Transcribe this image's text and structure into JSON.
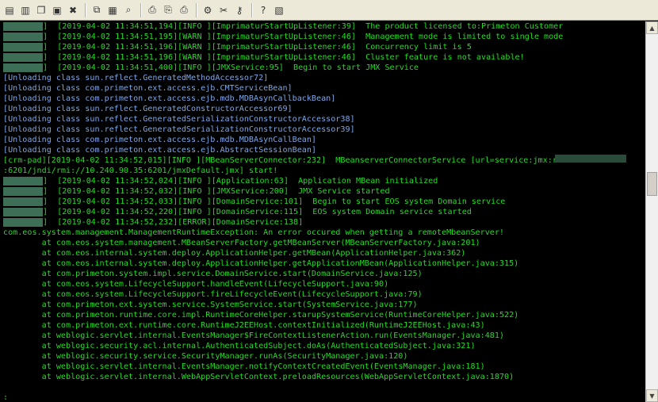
{
  "toolbar": {
    "buttons": [
      {
        "name": "new-window-icon",
        "glyph": "▤"
      },
      {
        "name": "new-session-icon",
        "glyph": "▥"
      },
      {
        "name": "open-icon",
        "glyph": "❐"
      },
      {
        "name": "duplicate-icon",
        "glyph": "▣"
      },
      {
        "name": "close-session-icon",
        "glyph": "✖"
      },
      {
        "sep": true
      },
      {
        "name": "copy-icon",
        "glyph": "⧉"
      },
      {
        "name": "paste-icon",
        "glyph": "▦"
      },
      {
        "name": "find-icon",
        "glyph": "⌕"
      },
      {
        "sep": true
      },
      {
        "name": "print-setup-icon",
        "glyph": "⎙"
      },
      {
        "name": "print-preview-icon",
        "glyph": "⎘"
      },
      {
        "name": "print-icon",
        "glyph": "⎙"
      },
      {
        "sep": true
      },
      {
        "name": "settings-icon",
        "glyph": "⚙"
      },
      {
        "name": "tools-icon",
        "glyph": "✂"
      },
      {
        "name": "key-icon",
        "glyph": "⚷"
      },
      {
        "sep": true
      },
      {
        "name": "help-icon",
        "glyph": "?"
      },
      {
        "name": "options-icon",
        "glyph": "▧"
      }
    ]
  },
  "console": {
    "lines": [
      {
        "color": "green",
        "blur": true,
        "text": "]  [2019-04-02 11:34:51,194][INFO ][ImprimaturStartUpListener:39]  The product licensed to:Primeton Customer"
      },
      {
        "color": "green",
        "blur": true,
        "text": "]  [2019-04-02 11:34:51,195][WARN ][ImprimaturStartUpListener:46]  Management mode is limited to single mode"
      },
      {
        "color": "green",
        "blur": true,
        "text": "]  [2019-04-02 11:34:51,196][WARN ][ImprimaturStartUpListener:46]  Concurrency limit is 5"
      },
      {
        "color": "green",
        "blur": true,
        "text": "]  [2019-04-02 11:34:51,196][WARN ][ImprimaturStartUpListener:46]  Cluster feature is not available!"
      },
      {
        "color": "green",
        "blur": true,
        "text": "]  [2019-04-02 11:34:51,400][INFO ][JMXService:95]  Begin to start JMX Service"
      },
      {
        "color": "blue",
        "text": "[Unloading class sun.reflect.GeneratedMethodAccessor72]"
      },
      {
        "color": "blue",
        "text": "[Unloading class com.primeton.ext.access.ejb.CMTServiceBean]"
      },
      {
        "color": "blue",
        "text": "[Unloading class com.primeton.ext.access.ejb.mdb.MDBAsynCallbackBean]"
      },
      {
        "color": "blue",
        "text": "[Unloading class sun.reflect.GeneratedConstructorAccessor69]"
      },
      {
        "color": "blue",
        "text": "[Unloading class sun.reflect.GeneratedSerializationConstructorAccessor38]"
      },
      {
        "color": "blue",
        "text": "[Unloading class sun.reflect.GeneratedSerializationConstructorAccessor39]"
      },
      {
        "color": "blue",
        "text": "[Unloading class com.primeton.ext.access.ejb.mdb.MDBAsynCallBean]"
      },
      {
        "color": "blue",
        "text": "[Unloading class com.primeton.ext.access.ejb.AbstractSessionBean]"
      },
      {
        "color": "green",
        "text": "[crm-pad][2019-04-02 11:34:52,015][INFO ][MBeanServerConnector:232]  MBeanserverConnectorService [url=service:jmx:rmi:"
      },
      {
        "color": "green",
        "text": ":6201/jndi/rmi://10.240.90.35:6201/jmxDefault.jmx] start!"
      },
      {
        "color": "green",
        "blur": true,
        "text": "]  [2019-04-02 11:34:52,024][INFO ][Application:63]  Application MBean initialized"
      },
      {
        "color": "green",
        "blur": true,
        "text": "]  [2019-04-02 11:34:52,032][INFO ][JMXService:200]  JMX Service started"
      },
      {
        "color": "green",
        "blur": true,
        "text": "]  [2019-04-02 11:34:52,033][INFO ][DomainService:101]  Begin to start EOS system Domain service"
      },
      {
        "color": "green",
        "blur": true,
        "text": "]  [2019-04-02 11:34:52,220][INFO ][DomainService:115]  EOS system Domain service started"
      },
      {
        "color": "green",
        "blur": true,
        "text": "]  [2019-04-02 11:34:52,232][ERROR][DomainService:138]"
      },
      {
        "color": "green",
        "text": "com.eos.system.management.ManagementRuntimeException: An error occured when getting a remoteMbeanServer!"
      },
      {
        "color": "green",
        "text": "        at com.eos.system.management.MBeanServerFactory.getMBeanServer(MBeanServerFactory.java:201)"
      },
      {
        "color": "green",
        "text": "        at com.eos.internal.system.deploy.ApplicationHelper.getMBean(ApplicationHelper.java:362)"
      },
      {
        "color": "green",
        "text": "        at com.eos.internal.system.deploy.ApplicationHelper.getApplicationMBean(ApplicationHelper.java:315)"
      },
      {
        "color": "green",
        "text": "        at com.primeton.system.impl.service.DomainService.start(DomainService.java:125)"
      },
      {
        "color": "green",
        "text": "        at com.eos.system.LifecycleSupport.handleEvent(LifecycleSupport.java:90)"
      },
      {
        "color": "green",
        "text": "        at com.eos.system.LifecycleSupport.fireLifecycleEvent(LifecycleSupport.java:79)"
      },
      {
        "color": "green",
        "text": "        at com.primeton.ext.system.service.SystemService.start(SystemService.java:177)"
      },
      {
        "color": "green",
        "text": "        at com.primeton.runtime.core.impl.RuntimeCoreHelper.starupSystemService(RuntimeCoreHelper.java:522)"
      },
      {
        "color": "green",
        "text": "        at com.primeton.ext.runtime.core.RuntimeJ2EEHost.contextInitialized(RuntimeJ2EEHost.java:43)"
      },
      {
        "color": "green",
        "text": "        at weblogic.servlet.internal.EventsManager$FireContextListenerAction.run(EventsManager.java:481)"
      },
      {
        "color": "green",
        "text": "        at weblogic.security.acl.internal.AuthenticatedSubject.doAs(AuthenticatedSubject.java:321)"
      },
      {
        "color": "green",
        "text": "        at weblogic.security.service.SecurityManager.runAs(SecurityManager.java:120)"
      },
      {
        "color": "green",
        "text": "        at weblogic.servlet.internal.EventsManager.notifyContextCreatedEvent(EventsManager.java:181)"
      },
      {
        "color": "green",
        "text": "        at weblogic.servlet.internal.WebAppServletContext.preloadResources(WebAppServletContext.java:1870)"
      },
      {
        "color": "green",
        "text": ""
      },
      {
        "color": "green",
        "text": ":"
      }
    ]
  },
  "colors": {
    "log_green": "#22dd22",
    "unloading_blue": "#7da7e8",
    "background": "#000000"
  }
}
